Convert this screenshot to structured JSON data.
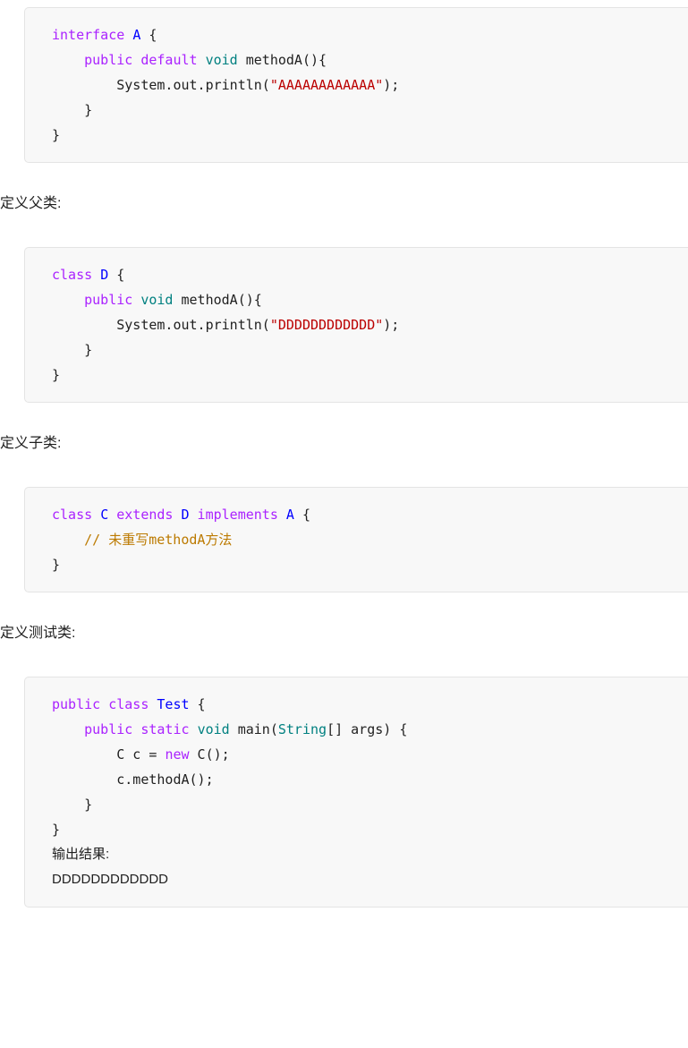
{
  "document": {
    "language": "java",
    "theme": {
      "code_background": "#f8f8f8",
      "code_border": "#e4e4e4",
      "text": "#1f1f1f",
      "keyword": "#aa22ff",
      "type_name": "#0000ff",
      "builtin_type": "#008080",
      "string": "#bb0000",
      "comment": "#bc7a00"
    }
  },
  "blocks": [
    {
      "id": "interface-a",
      "kind": "code",
      "lines": [
        [
          {
            "t": "interface ",
            "c": "kw"
          },
          {
            "t": "A",
            "c": "typ"
          },
          {
            "t": " {",
            "c": "pln"
          }
        ],
        [
          {
            "t": "    ",
            "c": "pln"
          },
          {
            "t": "public default ",
            "c": "kw"
          },
          {
            "t": "void",
            "c": "bi"
          },
          {
            "t": " methodA(){",
            "c": "pln"
          }
        ],
        [
          {
            "t": "        System.out.println(",
            "c": "pln"
          },
          {
            "t": "\"AAAAAAAAAAAA\"",
            "c": "str"
          },
          {
            "t": ");",
            "c": "pln"
          }
        ],
        [
          {
            "t": "    }",
            "c": "pln"
          }
        ],
        [
          {
            "t": "}",
            "c": "pln"
          }
        ]
      ]
    },
    {
      "id": "caption-parent",
      "kind": "caption",
      "text": "定义父类:"
    },
    {
      "id": "class-d",
      "kind": "code",
      "lines": [
        [
          {
            "t": "class ",
            "c": "kw"
          },
          {
            "t": "D",
            "c": "typ"
          },
          {
            "t": " {",
            "c": "pln"
          }
        ],
        [
          {
            "t": "    ",
            "c": "pln"
          },
          {
            "t": "public ",
            "c": "kw"
          },
          {
            "t": "void",
            "c": "bi"
          },
          {
            "t": " methodA(){",
            "c": "pln"
          }
        ],
        [
          {
            "t": "        System.out.println(",
            "c": "pln"
          },
          {
            "t": "\"DDDDDDDDDDDD\"",
            "c": "str"
          },
          {
            "t": ");",
            "c": "pln"
          }
        ],
        [
          {
            "t": "    }",
            "c": "pln"
          }
        ],
        [
          {
            "t": "}",
            "c": "pln"
          }
        ]
      ]
    },
    {
      "id": "caption-child",
      "kind": "caption",
      "text": "定义子类:"
    },
    {
      "id": "class-c",
      "kind": "code",
      "lines": [
        [
          {
            "t": "class ",
            "c": "kw"
          },
          {
            "t": "C",
            "c": "typ"
          },
          {
            "t": " extends ",
            "c": "kw"
          },
          {
            "t": "D",
            "c": "typ"
          },
          {
            "t": " implements ",
            "c": "kw"
          },
          {
            "t": "A",
            "c": "typ"
          },
          {
            "t": " {",
            "c": "pln"
          }
        ],
        [
          {
            "t": "    ",
            "c": "pln"
          },
          {
            "t": "// 未重写methodA方法",
            "c": "cmt"
          }
        ],
        [
          {
            "t": "}",
            "c": "pln"
          }
        ]
      ]
    },
    {
      "id": "caption-test",
      "kind": "caption",
      "text": "定义测试类:"
    },
    {
      "id": "class-test",
      "kind": "code",
      "lines": [
        [
          {
            "t": "public class ",
            "c": "kw"
          },
          {
            "t": "Test",
            "c": "typ"
          },
          {
            "t": " {",
            "c": "pln"
          }
        ],
        [
          {
            "t": "    ",
            "c": "pln"
          },
          {
            "t": "public static ",
            "c": "kw"
          },
          {
            "t": "void",
            "c": "bi"
          },
          {
            "t": " main(",
            "c": "pln"
          },
          {
            "t": "String",
            "c": "bi"
          },
          {
            "t": "[] args) {",
            "c": "pln"
          }
        ],
        [
          {
            "t": "        C c = ",
            "c": "pln"
          },
          {
            "t": "new",
            "c": "kw"
          },
          {
            "t": " C();",
            "c": "pln"
          }
        ],
        [
          {
            "t": "        c.methodA();",
            "c": "pln"
          }
        ],
        [
          {
            "t": "    }",
            "c": "pln"
          }
        ],
        [
          {
            "t": "}",
            "c": "pln"
          }
        ]
      ],
      "output": {
        "label": "输出结果:",
        "value": "DDDDDDDDDDDD"
      }
    }
  ]
}
